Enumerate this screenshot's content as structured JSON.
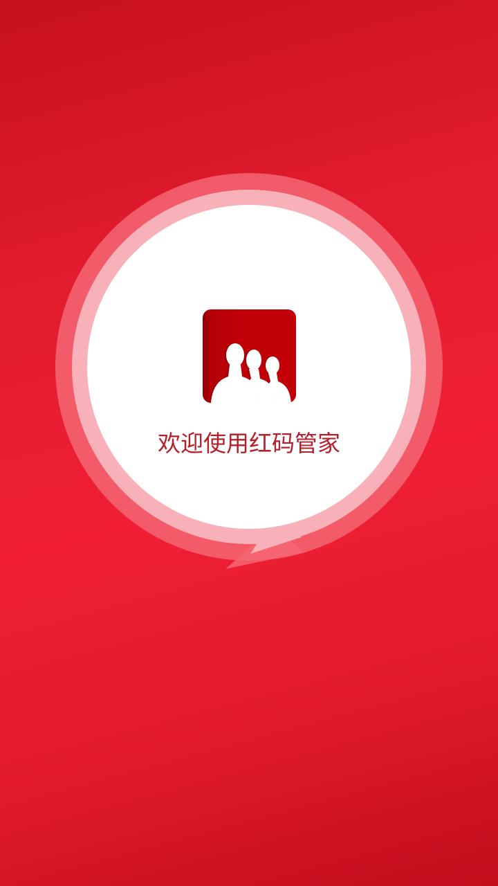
{
  "app": {
    "welcome_text": "欢迎使用红码管家",
    "icon": "people-group-icon"
  },
  "colors": {
    "background": "#e21c2e",
    "bubble_fill": "#ffffff",
    "bubble_inner_ring": "#f8b1b8",
    "bubble_outer_ring": "#f46673",
    "icon_background": "#c20008",
    "welcome_text": "#b41f2a"
  }
}
